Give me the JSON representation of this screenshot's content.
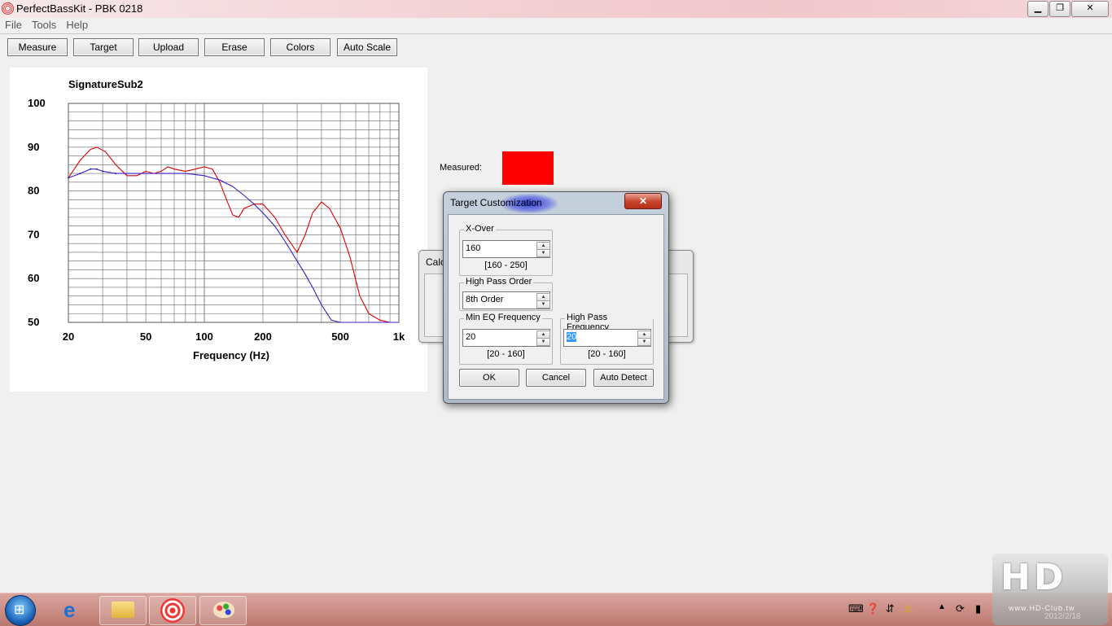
{
  "window": {
    "title": "PerfectBassKit - PBK 0218"
  },
  "menu": [
    "File",
    "Tools",
    "Help"
  ],
  "toolbar": [
    "Measure",
    "Target",
    "Upload",
    "Erase",
    "Colors",
    "Auto Scale"
  ],
  "legend": {
    "measured_label": "Measured:",
    "measured_color": "#ff0000"
  },
  "background_dialog": {
    "title_partial": "Calc"
  },
  "dialog": {
    "title": "Target Customization",
    "close_label": "✕",
    "xover": {
      "label": "X-Over",
      "value": "160",
      "range": "[160 - 250]"
    },
    "hp_order": {
      "label": "High Pass Order",
      "value": "8th Order"
    },
    "min_eq": {
      "label": "Min EQ Frequency",
      "value": "20",
      "range": "[20 - 160]"
    },
    "hp_freq": {
      "label": "High Pass Frequency",
      "value": "20",
      "range": "[20 - 160]"
    },
    "buttons": {
      "ok": "OK",
      "cancel": "Cancel",
      "auto": "Auto Detect"
    }
  },
  "watermark": {
    "logo": "HD",
    "url": "www.HD-Club.tw",
    "date": "2012/2/18"
  },
  "chart_data": {
    "type": "line",
    "title": "SignatureSub2",
    "xlabel": "Frequency (Hz)",
    "ylabel": "",
    "xscale": "log",
    "xlim": [
      20,
      1000
    ],
    "ylim": [
      50,
      100
    ],
    "x_ticks": [
      "20",
      "50",
      "100",
      "200",
      "500",
      "1k"
    ],
    "y_ticks": [
      "100",
      "90",
      "80",
      "70",
      "60",
      "50"
    ],
    "grid": true,
    "series": [
      {
        "color": "#dd0000",
        "x": [
          20,
          23,
          26,
          28,
          31,
          35,
          40,
          45,
          50,
          55,
          60,
          65,
          70,
          80,
          90,
          100,
          110,
          120,
          130,
          140,
          150,
          160,
          180,
          200,
          230,
          260,
          300,
          330,
          360,
          400,
          440,
          500,
          560,
          630,
          700,
          800,
          900
        ],
        "y": [
          83,
          87,
          89.5,
          90,
          89,
          86,
          83.5,
          83.5,
          84.5,
          84,
          84.5,
          85.5,
          85,
          84.5,
          85,
          85.5,
          85,
          82,
          78,
          74.5,
          74,
          76,
          77,
          77,
          74,
          70,
          66,
          70,
          75,
          77.5,
          76,
          71.5,
          65,
          56,
          52,
          50.5,
          50
        ]
      },
      {
        "color": "#3a1ec8",
        "dashed_until": 35,
        "x": [
          20,
          23,
          26,
          28,
          30,
          35,
          40,
          50,
          60,
          70,
          80,
          100,
          120,
          140,
          160,
          180,
          200,
          230,
          260,
          300,
          330,
          360,
          400,
          450,
          500,
          600,
          800,
          1000
        ],
        "y": [
          83,
          84,
          85,
          85,
          84.5,
          84,
          84,
          84,
          84,
          84,
          84,
          83.5,
          82.5,
          81,
          79,
          77,
          75,
          72,
          68.5,
          64,
          61,
          58,
          54,
          50.5,
          50,
          50,
          50,
          50
        ]
      }
    ]
  }
}
